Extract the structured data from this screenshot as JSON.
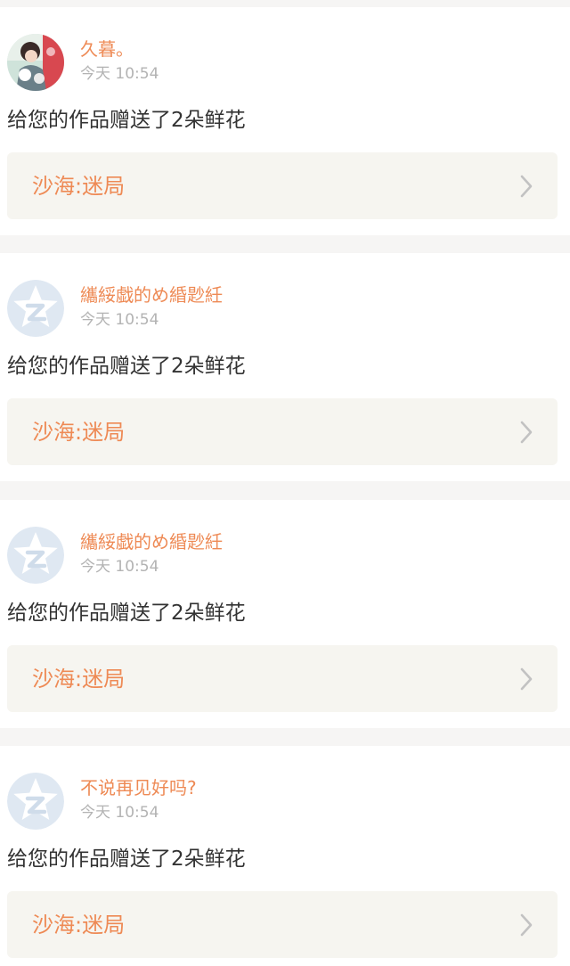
{
  "colors": {
    "accent": "#ee8a55",
    "text": "#333333",
    "muted": "#b3b3b3",
    "link_bg": "#f6f5f0",
    "page_bg": "#f6f5f4",
    "default_avatar_bg": "#dfe8f2",
    "default_avatar_star": "#ffffff",
    "default_avatar_mark": "#cfdcea"
  },
  "notifications": [
    {
      "avatar": "user-photo-avatar",
      "user": "久暮。",
      "time": "今天 10:54",
      "message": "给您的作品赠送了2朵鲜花",
      "work_title": "沙海:迷局",
      "chevron_icon": "chevron-right-icon"
    },
    {
      "avatar": "default-star-avatar",
      "user": "纗綏戯的め緍尟紝",
      "time": "今天 10:54",
      "message": "给您的作品赠送了2朵鲜花",
      "work_title": "沙海:迷局",
      "chevron_icon": "chevron-right-icon"
    },
    {
      "avatar": "default-star-avatar",
      "user": "纗綏戯的め緍尟紝",
      "time": "今天 10:54",
      "message": "给您的作品赠送了2朵鲜花",
      "work_title": "沙海:迷局",
      "chevron_icon": "chevron-right-icon"
    },
    {
      "avatar": "default-star-avatar",
      "user": "不说再见好吗?",
      "time": "今天 10:54",
      "message": "给您的作品赠送了2朵鲜花",
      "work_title": "沙海:迷局",
      "chevron_icon": "chevron-right-icon"
    }
  ]
}
